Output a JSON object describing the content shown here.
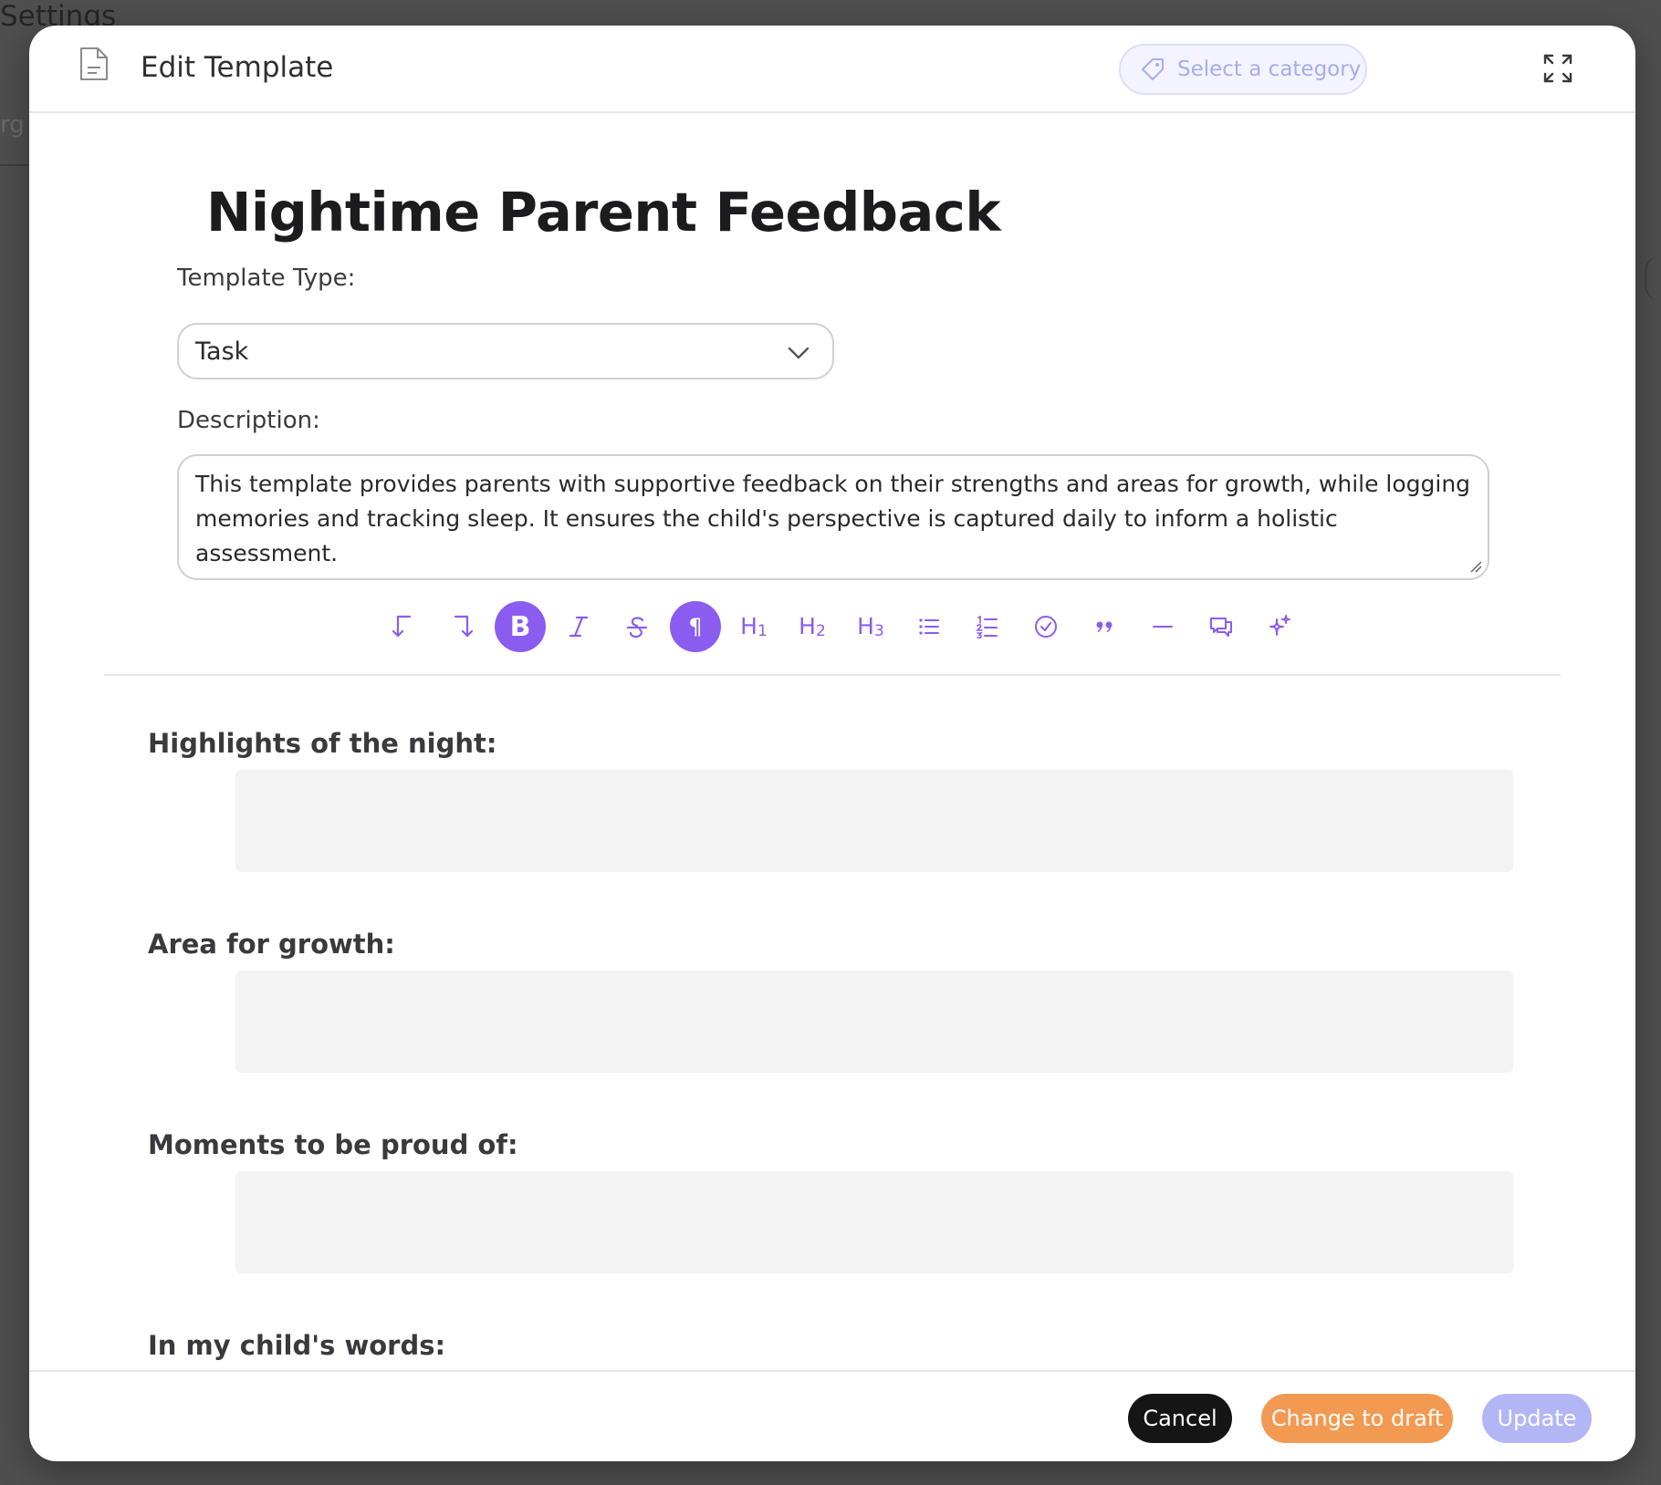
{
  "background": {
    "page_title": "Settings",
    "fragment": "rg"
  },
  "header": {
    "title": "Edit Template",
    "category_placeholder": "Select a category"
  },
  "document": {
    "title": "Nightime Parent Feedback",
    "template_type_label": "Template Type:",
    "template_type_value": "Task",
    "description_label": "Description:",
    "description_text": "This template provides parents with supportive feedback on their strengths and areas for growth, while logging memories and tracking sleep. It ensures the child's perspective is captured daily to inform a holistic assessment."
  },
  "toolbar": {
    "buttons": [
      "undo",
      "redo",
      "bold",
      "italic",
      "strikethrough",
      "paragraph",
      "heading-1",
      "heading-2",
      "heading-3",
      "bullet-list",
      "ordered-list",
      "task-list",
      "blockquote",
      "horizontal-rule",
      "comment",
      "ai-sparkle"
    ],
    "active": [
      "bold",
      "paragraph"
    ],
    "bold_glyph": "B",
    "paragraph_glyph": "¶",
    "h1": "H",
    "h2": "H",
    "h3": "H",
    "h1_sub": "1",
    "h2_sub": "2",
    "h3_sub": "3"
  },
  "sections": [
    {
      "label": "Highlights of the night:"
    },
    {
      "label": "Area for growth:"
    },
    {
      "label": "Moments to be proud of:"
    },
    {
      "label": "In my child's words:"
    }
  ],
  "footer": {
    "cancel_label": "Cancel",
    "draft_label": "Change to draft",
    "update_label": "Update"
  },
  "colors": {
    "accent": "#8b5cf0",
    "draft": "#f29a52",
    "update_disabled": "#b3b6f5",
    "cancel": "#151515"
  }
}
